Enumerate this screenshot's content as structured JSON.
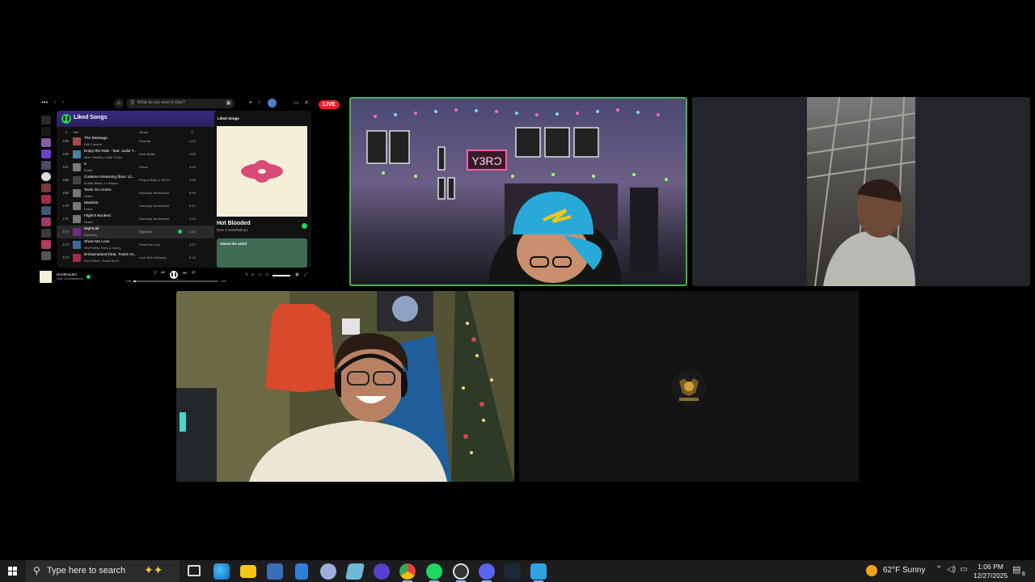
{
  "spotify": {
    "search_placeholder": "What do you want to play?",
    "playlist_title": "Liked Songs",
    "col_num": "#",
    "col_title": "Title",
    "col_album": "Album",
    "rows": [
      {
        "num": "165",
        "title": "The Message",
        "artist": "Still Corners",
        "album": "Slow Air",
        "duration": "4:02",
        "color": "#a34a4a"
      },
      {
        "num": "166",
        "title": "Enjoy the Ride - feat. Judie T...",
        "artist": "Marc Heatley, Judie Tzuke",
        "album": "Elixir Beats",
        "duration": "4:05",
        "color": "#4a7fa3"
      },
      {
        "num": "167",
        "title": "9",
        "artist": "Drake",
        "album": "Views",
        "duration": "4:16",
        "color": "#7a7a7a"
      },
      {
        "num": "168",
        "title": "Codeine Dreaming (feat. Lil...",
        "artist": "Kodak Black, Lil Wayne",
        "album": "Project Baby 2: All Gr...",
        "duration": "4:25",
        "color": "#444"
      },
      {
        "num": "169",
        "title": "Texts Go Green",
        "artist": "Drake",
        "album": "Honestly, Nevermind",
        "duration": "5:55",
        "color": "#777"
      },
      {
        "num": "170",
        "title": "Massive",
        "artist": "Drake",
        "album": "Honestly, Nevermind",
        "duration": "5:37",
        "color": "#777"
      },
      {
        "num": "171",
        "title": "Flight's Booked",
        "artist": "Drake",
        "album": "Honestly, Nevermind",
        "duration": "4:14",
        "color": "#777"
      },
      {
        "num": "172",
        "title": "Nightcall",
        "artist": "Kavinsky",
        "album": "Nightcall",
        "duration": "4:18",
        "color": "#6b2e7a",
        "active": true
      },
      {
        "num": "173",
        "title": "Show Me Love",
        "artist": "WizTheMc, bees & honey",
        "album": "Show Me Love",
        "duration": "3:07",
        "color": "#3a6a9a"
      },
      {
        "num": "174",
        "title": "Embarrassed (feat. Travis Sc...",
        "artist": "Don Toliver, Travis Scott",
        "album": "Love Sick (Deluxe)",
        "duration": "3:13",
        "color": "#a02e4a"
      }
    ],
    "now_playing_label": "Liked Songs",
    "now_playing_title": "Hot Blooded",
    "now_playing_artist": "New Constellations",
    "about_label": "About the artist",
    "player_title": "Hot Blooded",
    "player_artist": "New Constellations",
    "elapsed": "0:08",
    "total": "4:02",
    "progress": 0.03
  },
  "live_badge": "LIVE",
  "cameras": [
    {
      "name": "participant-1",
      "speaking": true
    },
    {
      "name": "participant-2",
      "speaking": false
    },
    {
      "name": "participant-3",
      "speaking": false
    },
    {
      "name": "participant-4",
      "speaking": false,
      "camera_off": true
    }
  ],
  "taskbar": {
    "search_placeholder": "Type here to search",
    "apps": [
      "task-view-icon",
      "edge-icon",
      "file-explorer-icon",
      "remote-desktop-icon",
      "calculator-icon",
      "app-icon",
      "notepad-icon",
      "browser-icon",
      "chrome-icon",
      "spotify-icon",
      "obs-icon",
      "discord-icon",
      "steam-icon",
      "maps-icon"
    ],
    "weather": "62°F  Sunny",
    "time": "1:06 PM",
    "date": "12/27/2025",
    "notification_count": "6"
  }
}
